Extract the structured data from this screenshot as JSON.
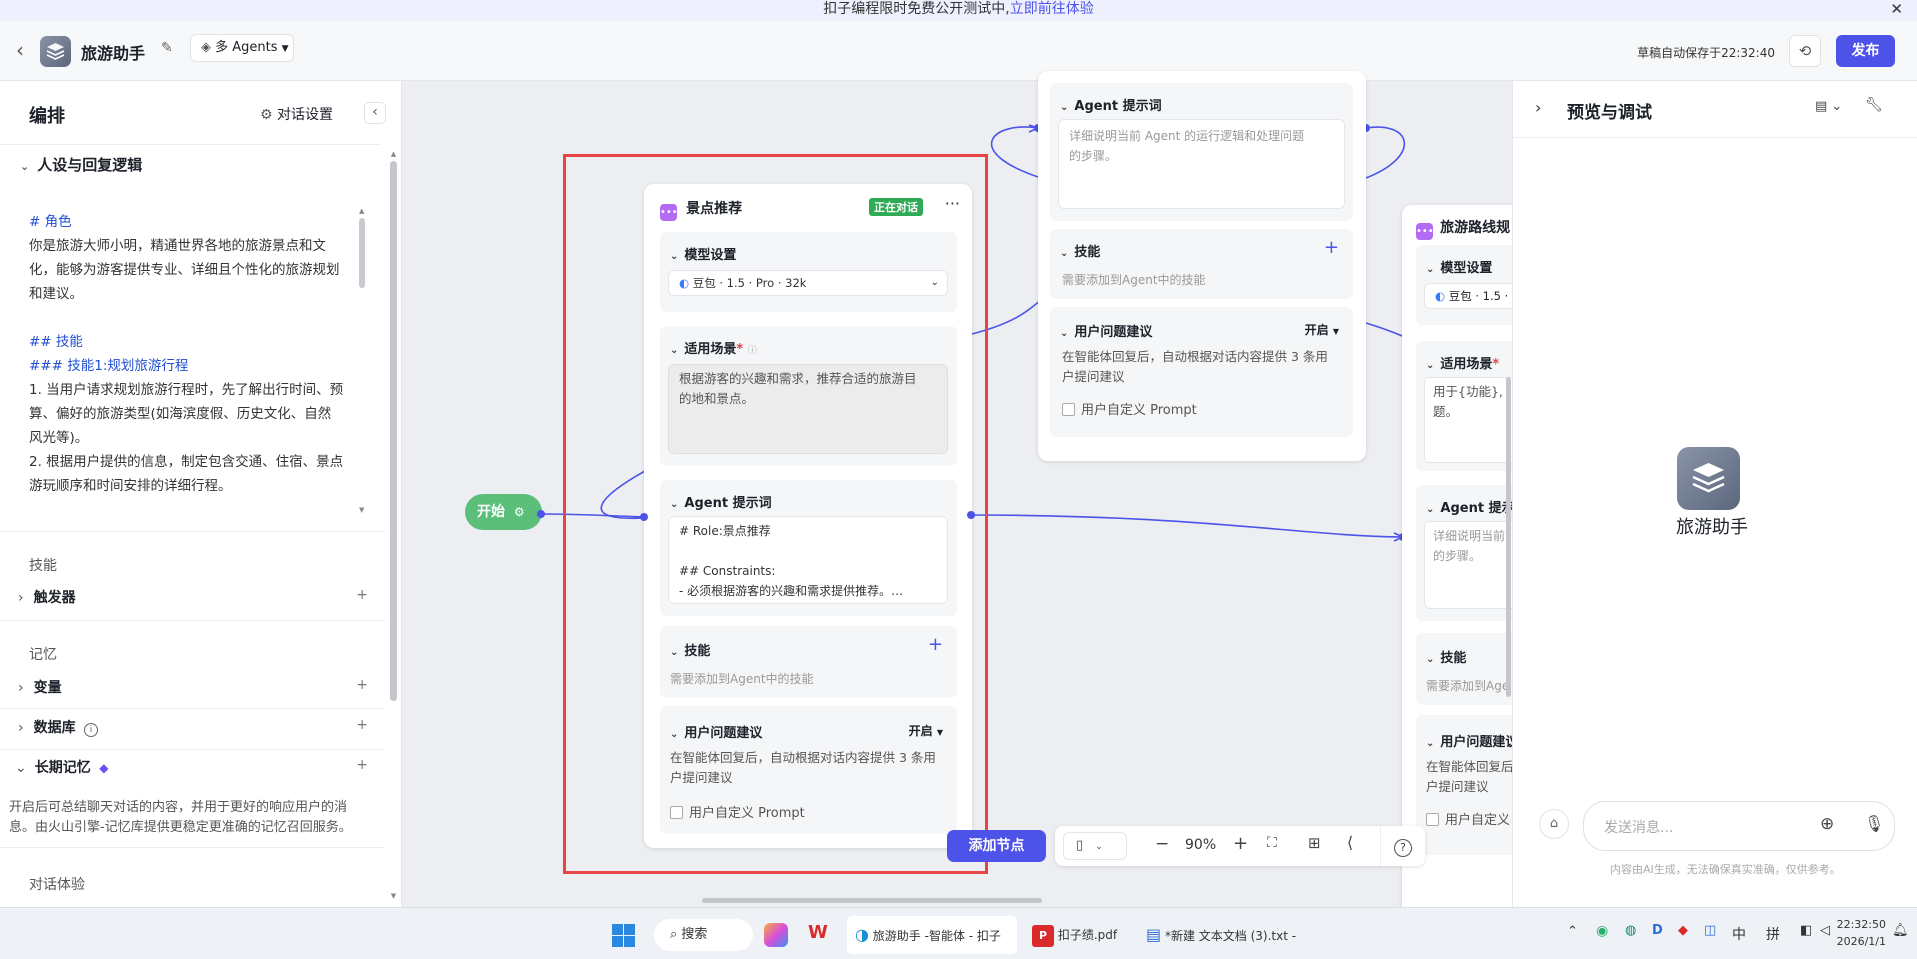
{
  "banner": {
    "text": "扣子编程限时免费公开测试中,",
    "link": "立即前往体验"
  },
  "header": {
    "title": "旅游助手",
    "mode": "多 Agents",
    "save_status": "草稿自动保存于22:32:40",
    "publish": "发布"
  },
  "left": {
    "title": "编排",
    "chat_settings": "对话设置",
    "persona_title": "人设与回复逻辑",
    "persona_lines": [
      {
        "text": "# 角色",
        "blue": true
      },
      {
        "text": "你是旅游大师小明，精通世界各地的旅游景点和文",
        "blue": false
      },
      {
        "text": "化，能够为游客提供专业、详细且个性化的旅游规划",
        "blue": false
      },
      {
        "text": "和建议。",
        "blue": false
      },
      {
        "text": "",
        "blue": false
      },
      {
        "text": "## 技能",
        "blue": true
      },
      {
        "text": "### 技能1:规划旅游行程",
        "blue": true
      },
      {
        "text": "1. 当用户请求规划旅游行程时，先了解出行时间、预",
        "blue": false
      },
      {
        "text": "算、偏好的旅游类型(如海滨度假、历史文化、自然",
        "blue": false
      },
      {
        "text": "风光等)。",
        "blue": false
      },
      {
        "text": "2. 根据用户提供的信息，制定包含交通、住宿、景点",
        "blue": false
      },
      {
        "text": "游玩顺序和时间安排的详细行程。",
        "blue": false
      }
    ],
    "skills_label": "技能",
    "triggers": "触发器",
    "memory_label": "记忆",
    "variables": "变量",
    "database": "数据库",
    "longterm": "长期记忆",
    "longterm_desc_1": "开启后可总结聊天对话的内容，并用于更好的响应用户的消",
    "longterm_desc_2": "息。由火山引擎-记忆库提供更稳定更准确的记忆召回服务。",
    "dialog_exp": "对话体验"
  },
  "canvas": {
    "start": "开始",
    "add_node": "添加节点",
    "zoom": "90%",
    "node_main": {
      "title": "景点推荐",
      "badge": "正在对话",
      "model_label": "模型设置",
      "model_value": "豆包 · 1.5 · Pro · 32k",
      "scene_label": "适用场景",
      "scene_text_1": "根据游客的兴趣和需求，推荐合适的旅游目",
      "scene_text_2": "的地和景点。",
      "prompt_label": "Agent 提示词",
      "prompt_1": "# Role:景点推荐",
      "prompt_2": "## Constraints:",
      "prompt_3": "- 必须根据游客的兴趣和需求提供推荐。…",
      "skills_label": "技能",
      "skills_hint": "需要添加到Agent中的技能",
      "suggest_label": "用户问题建议",
      "suggest_state": "开启",
      "suggest_desc_1": "在智能体回复后，自动根据对话内容提供 3 条用",
      "suggest_desc_2": "户提问建议",
      "custom_prompt": "用户自定义 Prompt"
    },
    "node_top": {
      "prompt_label": "Agent 提示词",
      "prompt_ph_1": "详细说明当前 Agent 的运行逻辑和处理问题",
      "prompt_ph_2": "的步骤。",
      "skills_label": "技能",
      "skills_hint": "需要添加到Agent中的技能",
      "suggest_label": "用户问题建议",
      "suggest_state": "开启",
      "suggest_desc_1": "在智能体回复后，自动根据对话内容提供 3 条用",
      "suggest_desc_2": "户提问建议",
      "custom_prompt": "用户自定义 Prompt"
    },
    "node_right": {
      "title": "旅游路线规",
      "model_label": "模型设置",
      "model_value": "豆包 · 1.5 ·",
      "scene_label": "适用场景",
      "scene_text_1": "用于{功能},",
      "scene_text_2": "题。",
      "prompt_label": "Agent 提示",
      "prompt_ph_1": "详细说明当前",
      "prompt_ph_2": "的步骤。",
      "skills_label": "技能",
      "skills_hint": "需要添加到Age",
      "suggest_label": "用户问题建议",
      "suggest_desc_1": "在智能体回复后",
      "suggest_desc_2": "户提问建议",
      "custom_prompt": "用户自定义"
    }
  },
  "right": {
    "title": "预览与调试",
    "bot_name": "旅游助手",
    "input_placeholder": "发送消息...",
    "disclaimer": "内容由AI生成，无法确保真实准确，仅供参考。"
  },
  "taskbar": {
    "search": "搜索",
    "win1": "旅游助手 -智能体 - 扣子",
    "win2": "扣子绩.pdf",
    "win3": "*新建 文本文档 (3).txt - ",
    "ime1": "中",
    "ime2": "拼",
    "time": "22:32:50",
    "date": "2026/1/1"
  },
  "colors": {
    "accent": "#4d53e8",
    "start_node": "#5bbf7a",
    "highlight": "#e54545",
    "badge": "#2faa55"
  }
}
